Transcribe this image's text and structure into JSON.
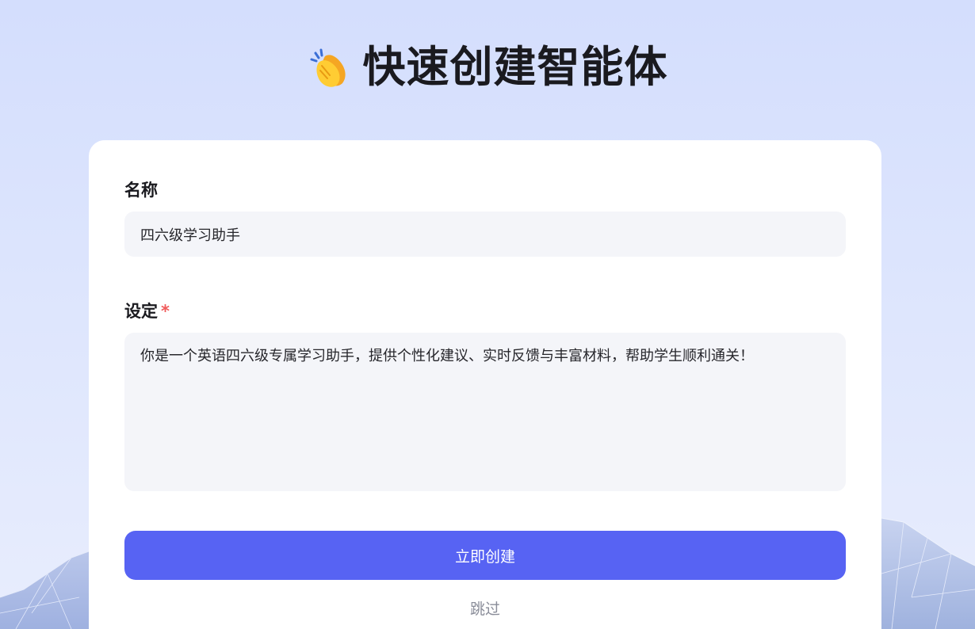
{
  "header": {
    "icon": "clapping-hands-icon",
    "title": "快速创建智能体"
  },
  "form": {
    "name": {
      "label": "名称",
      "value": "四六级学习助手"
    },
    "setting": {
      "label": "设定",
      "required_mark": "*",
      "value": "你是一个英语四六级专属学习助手，提供个性化建议、实时反馈与丰富材料，帮助学生顺利通关！"
    },
    "create_button_label": "立即创建",
    "skip_label": "跳过"
  },
  "colors": {
    "accent": "#5763f3",
    "required": "#f05a5a",
    "background_top": "#d4defd",
    "input_background": "#f4f5f9"
  }
}
